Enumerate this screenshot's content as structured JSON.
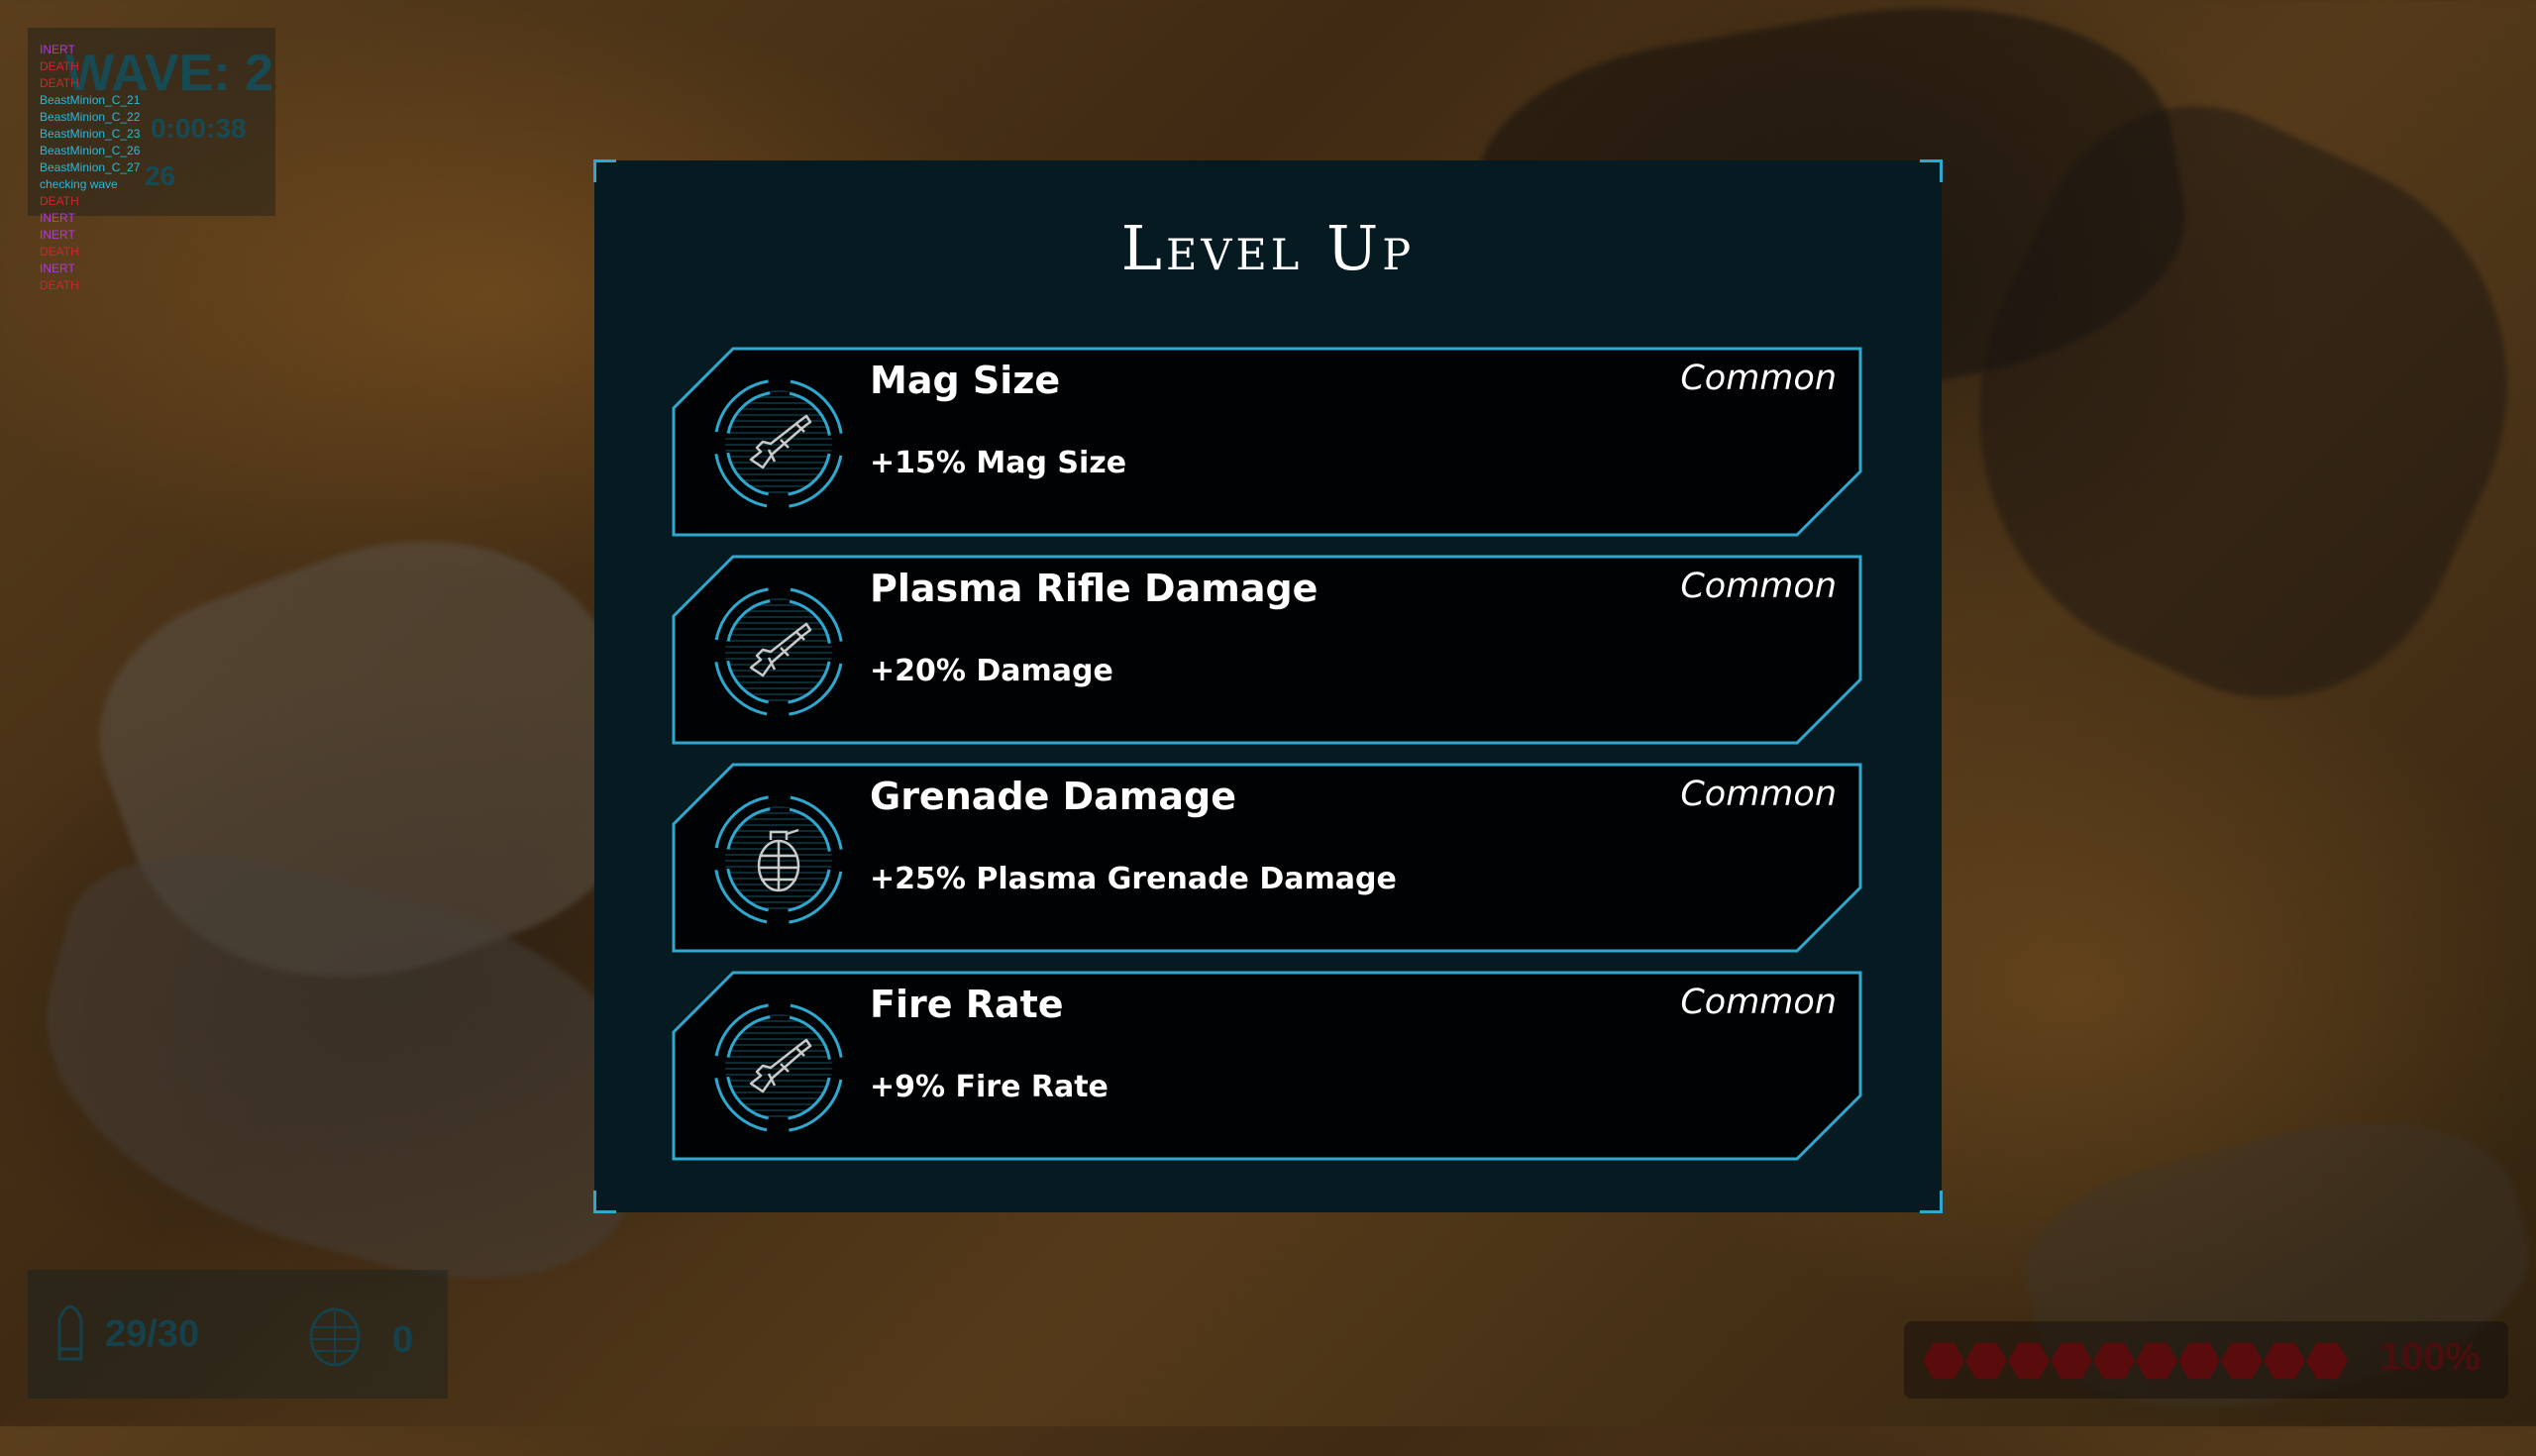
{
  "debug": {
    "wave_label": "WAVE: 2",
    "timer": "0:00:38",
    "count": "26",
    "log": [
      {
        "text": "INERT",
        "color": "#b23ad9"
      },
      {
        "text": "DEATH",
        "color": "#d2242f"
      },
      {
        "text": "DEATH",
        "color": "#d2242f"
      },
      {
        "text": "BeastMinion_C_21",
        "color": "#2fb7d8"
      },
      {
        "text": "BeastMinion_C_22",
        "color": "#2fb7d8"
      },
      {
        "text": "BeastMinion_C_23",
        "color": "#2fb7d8"
      },
      {
        "text": "BeastMinion_C_26",
        "color": "#2fb7d8"
      },
      {
        "text": "BeastMinion_C_27",
        "color": "#2fb7d8"
      },
      {
        "text": "checking wave",
        "color": "#2fb7d8"
      },
      {
        "text": "DEATH",
        "color": "#d2242f"
      },
      {
        "text": "INERT",
        "color": "#b23ad9"
      },
      {
        "text": "INERT",
        "color": "#b23ad9"
      },
      {
        "text": "DEATH",
        "color": "#d2242f"
      },
      {
        "text": "INERT",
        "color": "#b23ad9"
      },
      {
        "text": "DEATH",
        "color": "#d2242f"
      }
    ]
  },
  "panel": {
    "title": "Level Up",
    "accent": "#2ea8cf",
    "background": "#061b21",
    "upgrades": [
      {
        "name": "Mag Size",
        "rarity": "Common",
        "description": "+15% Mag Size",
        "icon": "rifle-icon"
      },
      {
        "name": "Plasma Rifle Damage",
        "rarity": "Common",
        "description": "+20% Damage",
        "icon": "rifle-icon"
      },
      {
        "name": "Grenade Damage",
        "rarity": "Common",
        "description": "+25% Plasma Grenade Damage",
        "icon": "grenade-icon"
      },
      {
        "name": "Fire Rate",
        "rarity": "Common",
        "description": "+9% Fire Rate",
        "icon": "rifle-icon"
      }
    ]
  },
  "hud": {
    "ammo": "29/30",
    "grenades": "0",
    "health": "100%",
    "health_fraction": 1.0,
    "health_segments": 10,
    "health_color": "#5a0b0b"
  }
}
